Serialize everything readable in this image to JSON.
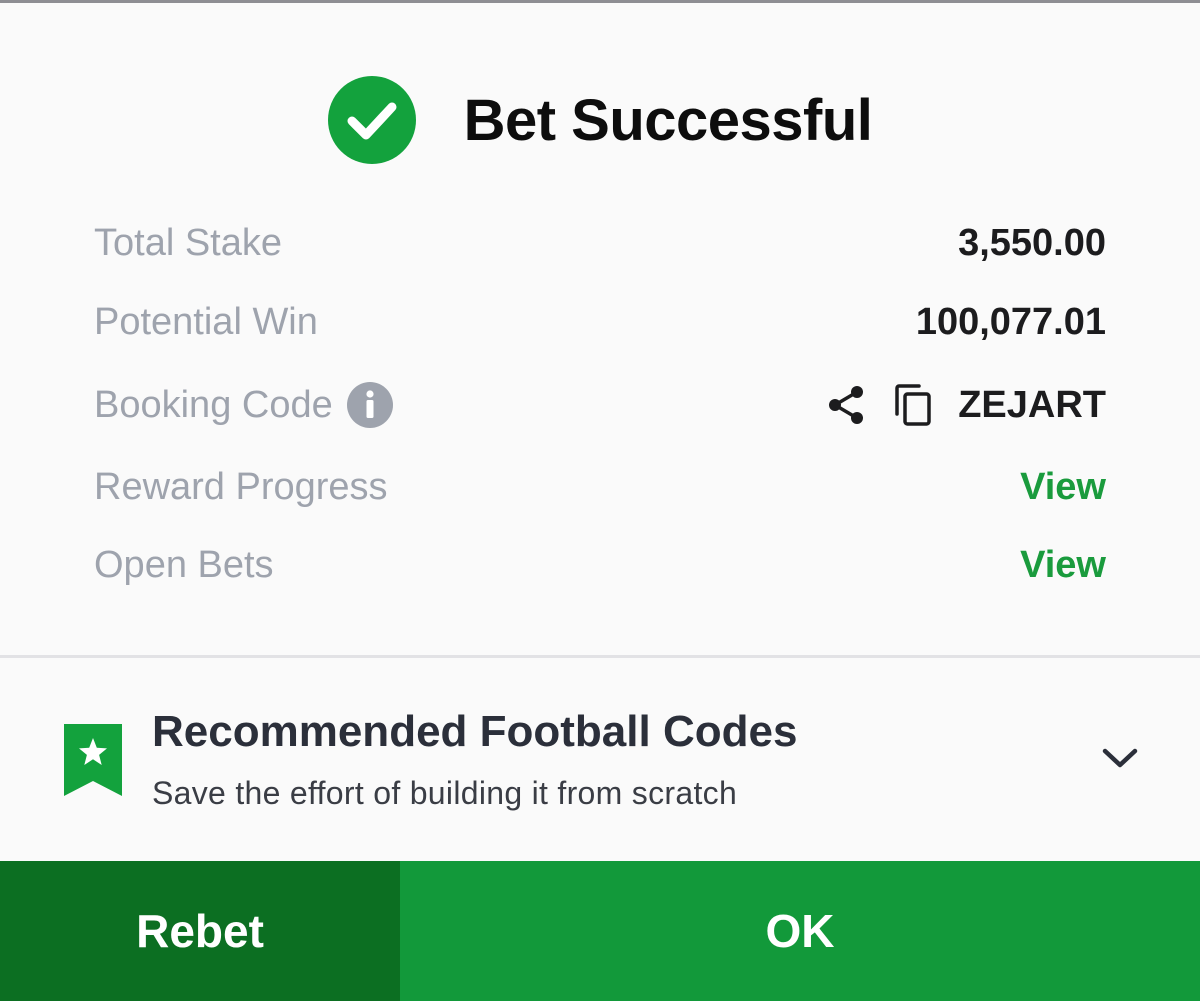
{
  "header": {
    "title": "Bet Successful",
    "icon": "check-circle-icon",
    "accent": "#13a23d"
  },
  "summary": {
    "total_stake": {
      "label": "Total Stake",
      "value": "3,550.00"
    },
    "potential_win": {
      "label": "Potential Win",
      "value": "100,077.01"
    },
    "booking_code": {
      "label": "Booking Code",
      "code": "ZEJART",
      "icons": [
        "info-icon",
        "share-icon",
        "copy-icon"
      ]
    },
    "reward_progress": {
      "label": "Reward Progress",
      "link": "View"
    },
    "open_bets": {
      "label": "Open Bets",
      "link": "View"
    }
  },
  "recommended": {
    "title": "Recommended Football Codes",
    "subtitle": "Save the effort of building it from scratch",
    "icon": "bookmark-star-icon",
    "toggle_icon": "chevron-down-icon"
  },
  "footer": {
    "rebet_label": "Rebet",
    "ok_label": "OK",
    "rebet_color": "#0c6f22",
    "ok_color": "#12993a"
  }
}
